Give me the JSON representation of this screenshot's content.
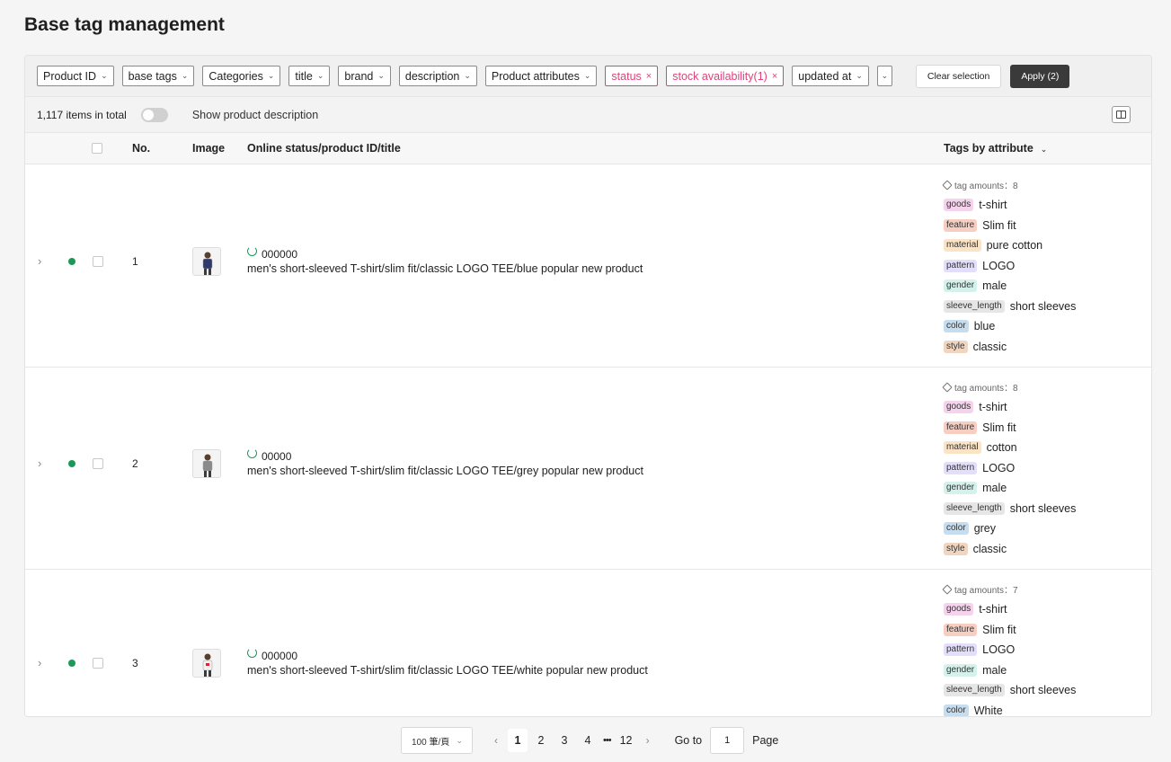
{
  "page_title": "Base tag management",
  "filters": [
    {
      "label": "Product ID",
      "active": false
    },
    {
      "label": "base tags",
      "active": false
    },
    {
      "label": "Categories",
      "active": false
    },
    {
      "label": "title",
      "active": false
    },
    {
      "label": "brand",
      "active": false
    },
    {
      "label": "description",
      "active": false
    },
    {
      "label": "Product attributes",
      "active": false
    },
    {
      "label": "status",
      "active": true
    },
    {
      "label": "stock availability(1)",
      "active": true
    },
    {
      "label": "updated at",
      "active": false
    }
  ],
  "clear_label": "Clear selection",
  "apply_label": "Apply (2)",
  "summary": {
    "count": "1,117 items in total",
    "show_desc": "Show product description"
  },
  "columns": {
    "no": "No.",
    "image": "Image",
    "status": "Online status/product ID/title",
    "tags": "Tags by attribute"
  },
  "tag_colors": {
    "goods": "#f6d3ec",
    "feature": "#f7cfc2",
    "material": "#fbe3c6",
    "pattern": "#e3defa",
    "gender": "#d4f1ec",
    "sleeve_length": "#e6e6e6",
    "color": "#c6ddf0",
    "style": "#f0d6c0"
  },
  "rows": [
    {
      "no": "1",
      "pid": "000000",
      "title": "men's short-sleeved T-shirt/slim fit/classic LOGO TEE/blue popular new product",
      "tag_amounts": "tag amounts：8",
      "tags": [
        {
          "key": "goods",
          "value": "t-shirt"
        },
        {
          "key": "feature",
          "value": "Slim fit"
        },
        {
          "key": "material",
          "value": "pure cotton"
        },
        {
          "key": "pattern",
          "value": "LOGO"
        },
        {
          "key": "gender",
          "value": "male"
        },
        {
          "key": "sleeve_length",
          "value": "short sleeves"
        },
        {
          "key": "color",
          "value": "blue"
        },
        {
          "key": "style",
          "value": "classic"
        }
      ]
    },
    {
      "no": "2",
      "pid": "00000",
      "title": "men's short-sleeved T-shirt/slim fit/classic LOGO TEE/grey popular new product",
      "tag_amounts": "tag amounts：8",
      "tags": [
        {
          "key": "goods",
          "value": "t-shirt"
        },
        {
          "key": "feature",
          "value": "Slim fit"
        },
        {
          "key": "material",
          "value": "cotton"
        },
        {
          "key": "pattern",
          "value": "LOGO"
        },
        {
          "key": "gender",
          "value": "male"
        },
        {
          "key": "sleeve_length",
          "value": "short sleeves"
        },
        {
          "key": "color",
          "value": "grey"
        },
        {
          "key": "style",
          "value": "classic"
        }
      ]
    },
    {
      "no": "3",
      "pid": "000000",
      "title": "men's short-sleeved T-shirt/slim fit/classic LOGO TEE/white popular new product",
      "tag_amounts": "tag amounts：7",
      "tags": [
        {
          "key": "goods",
          "value": "t-shirt"
        },
        {
          "key": "feature",
          "value": "Slim fit"
        },
        {
          "key": "pattern",
          "value": "LOGO"
        },
        {
          "key": "gender",
          "value": "male"
        },
        {
          "key": "sleeve_length",
          "value": "short sleeves"
        },
        {
          "key": "color",
          "value": "White"
        }
      ]
    }
  ],
  "pagination": {
    "page_size": "100 筆/頁",
    "pages": [
      "1",
      "2",
      "3",
      "4"
    ],
    "ellipsis": "•••",
    "last": "12",
    "goto": "Go to",
    "goto_value": "1",
    "page_word": "Page"
  }
}
